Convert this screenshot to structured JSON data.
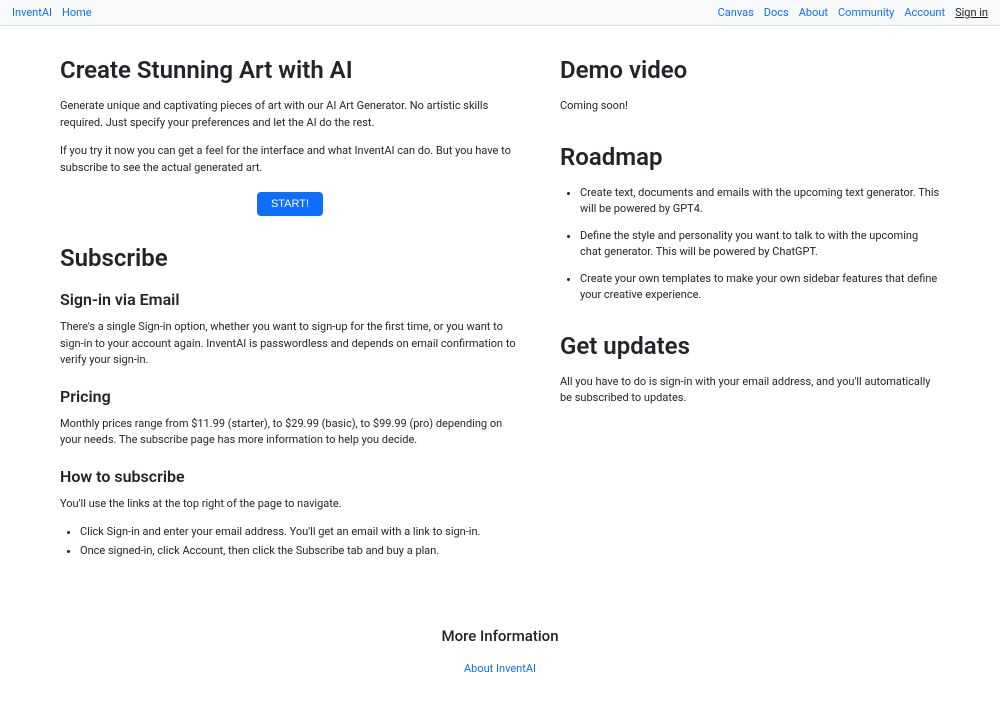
{
  "nav": {
    "brand": "InventAI",
    "home": "Home",
    "canvas": "Canvas",
    "docs": "Docs",
    "about": "About",
    "community": "Community",
    "account": "Account",
    "signin": "Sign in"
  },
  "hero": {
    "title": "Create Stunning Art with AI",
    "p1": "Generate unique and captivating pieces of art with our AI Art Generator. No artistic skills required. Just specify your preferences and let the AI do the rest.",
    "p2": "If you try it now you can get a feel for the interface and what InventAI can do. But you have to subscribe to see the actual generated art.",
    "start_label": "START!"
  },
  "subscribe": {
    "title": "Subscribe",
    "signin_heading": "Sign-in via Email",
    "signin_text": "There's a single Sign-in option, whether you want to sign-up for the first time, or you want to sign-in to your account again. InventAI is passwordless and depends on email confirmation to verify your sign-in.",
    "pricing_heading": "Pricing",
    "pricing_text": "Monthly prices range from $11.99 (starter), to $29.99 (basic), to $99.99 (pro) depending on your needs. The subscribe page has more information to help you decide.",
    "how_heading": "How to subscribe",
    "how_intro": "You'll use the links at the top right of the page to navigate.",
    "how_items": [
      "Click Sign-in and enter your email address. You'll get an email with a link to sign-in.",
      "Once signed-in, click Account, then click the Subscribe tab and buy a plan."
    ]
  },
  "demo": {
    "title": "Demo video",
    "text": "Coming soon!"
  },
  "roadmap": {
    "title": "Roadmap",
    "items": [
      "Create text, documents and emails with the upcoming text generator. This will be powered by GPT4.",
      "Define the style and personality you want to talk to with the upcoming chat generator. This will be powered by ChatGPT.",
      "Create your own templates to make your own sidebar features that define your creative experience."
    ]
  },
  "updates": {
    "title": "Get updates",
    "text": "All you have to do is sign-in with your email address, and you'll automatically be subscribed to updates."
  },
  "footer": {
    "heading": "More Information",
    "about_link": "About InventAI"
  }
}
